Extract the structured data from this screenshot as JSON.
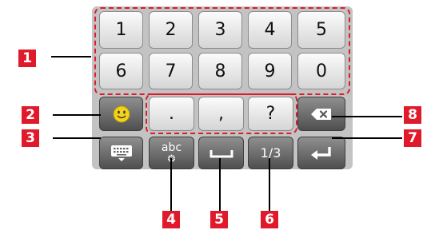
{
  "keys": {
    "row1": [
      "1",
      "2",
      "3",
      "4",
      "5"
    ],
    "row2": [
      "6",
      "7",
      "8",
      "9",
      "0"
    ],
    "punctuation": [
      ".",
      ",",
      "?"
    ],
    "abc": "abc",
    "page": "1/3"
  },
  "callouts": [
    "1",
    "2",
    "3",
    "4",
    "5",
    "6",
    "7",
    "8"
  ],
  "colors": {
    "callout": "#e01a2a",
    "keyboard_bg": "#c3c3c3"
  },
  "icons": {
    "emoji": "smiley-icon",
    "hide_keyboard": "keyboard-hide-icon",
    "settings": "gear-icon",
    "space": "space-bar-icon",
    "backspace": "backspace-icon",
    "enter": "enter-icon"
  }
}
